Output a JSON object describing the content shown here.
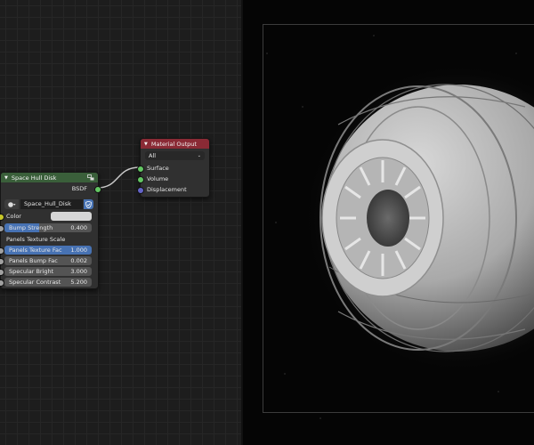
{
  "node_editor": {
    "group_node": {
      "title": "Space Hull Disk",
      "output_label": "BSDF",
      "datablock_name": "Space_Hull_Disk",
      "header_color": "#3a5f3a",
      "inputs": [
        {
          "label": "Color",
          "value": "",
          "type": "color"
        },
        {
          "label": "Bump Strength",
          "value": "0.400",
          "type": "slider"
        },
        {
          "label": "Panels Texture Scale",
          "value": "",
          "type": "heading"
        },
        {
          "label": "Panels Texture Fac",
          "value": "1.000",
          "type": "slider"
        },
        {
          "label": "Panels Bump Fac",
          "value": "0.002",
          "type": "field"
        },
        {
          "label": "Specular Bright",
          "value": "3.000",
          "type": "field"
        },
        {
          "label": "Specular Contrast",
          "value": "5.200",
          "type": "field"
        }
      ]
    },
    "output_node": {
      "title": "Material Output",
      "target": "All",
      "header_color": "#8a2a35",
      "inputs": [
        "Surface",
        "Volume",
        "Displacement"
      ]
    }
  },
  "colors": {
    "shader_socket": "#63c763",
    "vector_socket": "#6363c7",
    "slider_fill": "#4772b3",
    "color_swatch": "#d6d6d6"
  }
}
